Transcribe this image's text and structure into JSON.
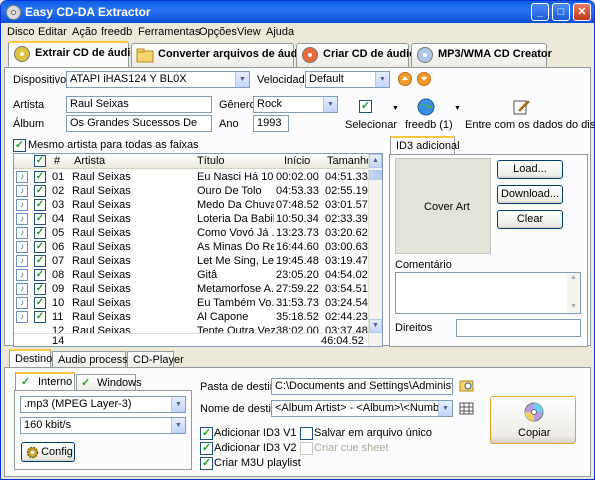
{
  "window": {
    "title": "Easy CD-DA Extractor"
  },
  "menu": [
    "Disco",
    "Editar",
    "Ação",
    "freedb",
    "Ferramentas",
    "Opções",
    "View",
    "Ajuda"
  ],
  "main_tabs": [
    "Extrair CD de áudio",
    "Converter arquivos de áudio",
    "Criar CD de áudio",
    "MP3/WMA CD Creator"
  ],
  "device": {
    "label": "Dispositivos",
    "value": "ATAPI iHAS124   Y BL0X",
    "speed_label": "Velocidade",
    "speed_value": "Default"
  },
  "album_info": {
    "artist_label": "Artista",
    "artist_value": "Raul Seixas",
    "album_label": "Álbum",
    "album_value": "Os Grandes Sucessos De",
    "genre_label": "Gênero",
    "genre_value": "Rock",
    "year_label": "Ano",
    "year_value": "1993"
  },
  "toolbar": {
    "select_label": "Selecionar",
    "freedb_label": "freedb (1)",
    "enter_label": "Entre com os dados do disco"
  },
  "same_artist_label": "Mesmo artista para todas as faixas",
  "table": {
    "headers": [
      "#",
      "Artista",
      "Título",
      "Início",
      "Tamanho"
    ],
    "rows": [
      {
        "n": "01",
        "artist": "Raul Seixas",
        "title": "Eu Nasci Há 10 ...",
        "start": "00:02.00",
        "size": "04:51.33"
      },
      {
        "n": "02",
        "artist": "Raul Seixas",
        "title": "Ouro De Tolo",
        "start": "04:53.33",
        "size": "02:55.19"
      },
      {
        "n": "03",
        "artist": "Raul Seixas",
        "title": "Medo Da Chuva",
        "start": "07:48.52",
        "size": "03:01.57"
      },
      {
        "n": "04",
        "artist": "Raul Seixas",
        "title": "Loteria Da Babil...",
        "start": "10:50.34",
        "size": "02:33.39"
      },
      {
        "n": "05",
        "artist": "Raul Seixas",
        "title": "Como Vovó Já ...",
        "start": "13:23.73",
        "size": "03:20.62"
      },
      {
        "n": "06",
        "artist": "Raul Seixas",
        "title": "As Minas Do Re...",
        "start": "16:44.60",
        "size": "03:00.63"
      },
      {
        "n": "07",
        "artist": "Raul Seixas",
        "title": "Let Me Sing, Le...",
        "start": "19:45.48",
        "size": "03:19.47"
      },
      {
        "n": "08",
        "artist": "Raul Seixas",
        "title": "Gitâ",
        "start": "23:05.20",
        "size": "04:54.02"
      },
      {
        "n": "09",
        "artist": "Raul Seixas",
        "title": "Metamorfose A...",
        "start": "27:59.22",
        "size": "03:54.51"
      },
      {
        "n": "10",
        "artist": "Raul Seixas",
        "title": "Eu Também Vo...",
        "start": "31:53.73",
        "size": "03:24.54"
      },
      {
        "n": "11",
        "artist": "Raul Seixas",
        "title": "Al Capone",
        "start": "35:18.52",
        "size": "02:44.23"
      }
    ],
    "partial_row": {
      "n": "12",
      "artist": "Raul Seixas",
      "title": "Tente Outra Vez",
      "start": "38:02.00",
      "size": "03:37.48"
    },
    "footer_count": "14",
    "footer_total": "46:04.52"
  },
  "id3": {
    "tab": "ID3 adicional",
    "cover_label": "Cover Art",
    "load_btn": "Load...",
    "download_btn": "Download...",
    "clear_btn": "Clear",
    "comment_label": "Comentário",
    "rights_label": "Direitos"
  },
  "bottom_tabs": [
    "Destino",
    "Audio processing",
    "CD-Player"
  ],
  "dest": {
    "internal_tab": "Interno",
    "windows_tab": "Windows",
    "format_value": ".mp3 (MPEG Layer-3)",
    "bitrate_value": "160 kbit/s",
    "config_btn": "Config",
    "folder_label": "Pasta de destino",
    "folder_value": "C:\\Documents and Settings\\Administrador\\De",
    "name_label": "Nome de destino",
    "name_value": "<Album Artist> - <Album>\\<Number>. <",
    "id3v1_label": "Adicionar ID3 V1",
    "id3v2_label": "Adicionar ID3 V2",
    "m3u_label": "Criar M3U playlist",
    "single_label": "Salvar em arquivo único",
    "cue_label": "Criar cue sheet",
    "copy_btn": "Copiar"
  }
}
